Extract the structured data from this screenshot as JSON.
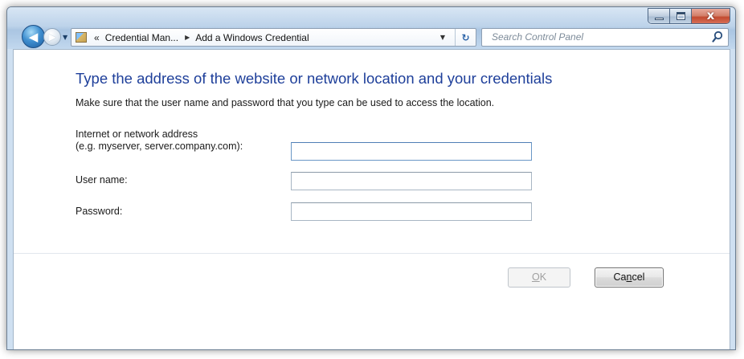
{
  "window": {
    "caption_buttons": {
      "minimize_icon": "minimize-icon",
      "maximize_icon": "maximize-icon",
      "close_icon": "close-icon",
      "close_glyph": "x"
    }
  },
  "nav": {
    "back_icon": "back-arrow-icon",
    "forward_icon": "forward-arrow-icon",
    "back_glyph": "◀",
    "forward_glyph": "▶"
  },
  "address_bar": {
    "location_icon": "control-panel-icon",
    "overflow_chevron": "«",
    "breadcrumbs": [
      "Credential Man...",
      "Add a Windows Credential"
    ],
    "separator_glyph": "▶",
    "dropdown_glyph": "▼",
    "refresh_glyph": "↻"
  },
  "search": {
    "placeholder": "Search Control Panel",
    "icon": "search-icon"
  },
  "page": {
    "title": "Type the address of the website or network location and your credentials",
    "subtitle": "Make sure that the user name and password that you type can be used to access the location."
  },
  "form": {
    "address_label_line1": "Internet or network address",
    "address_label_line2": "(e.g. myserver, server.company.com):",
    "address_value": "",
    "username_label": "User name:",
    "username_value": "",
    "password_label": "Password:",
    "password_value": ""
  },
  "buttons": {
    "ok_prefix": "",
    "ok_mnemonic": "O",
    "ok_suffix": "K",
    "cancel_prefix": "Ca",
    "cancel_mnemonic": "n",
    "cancel_suffix": "cel"
  },
  "colors": {
    "title": "#1e3f9a",
    "close_button": "#c34a2f"
  }
}
